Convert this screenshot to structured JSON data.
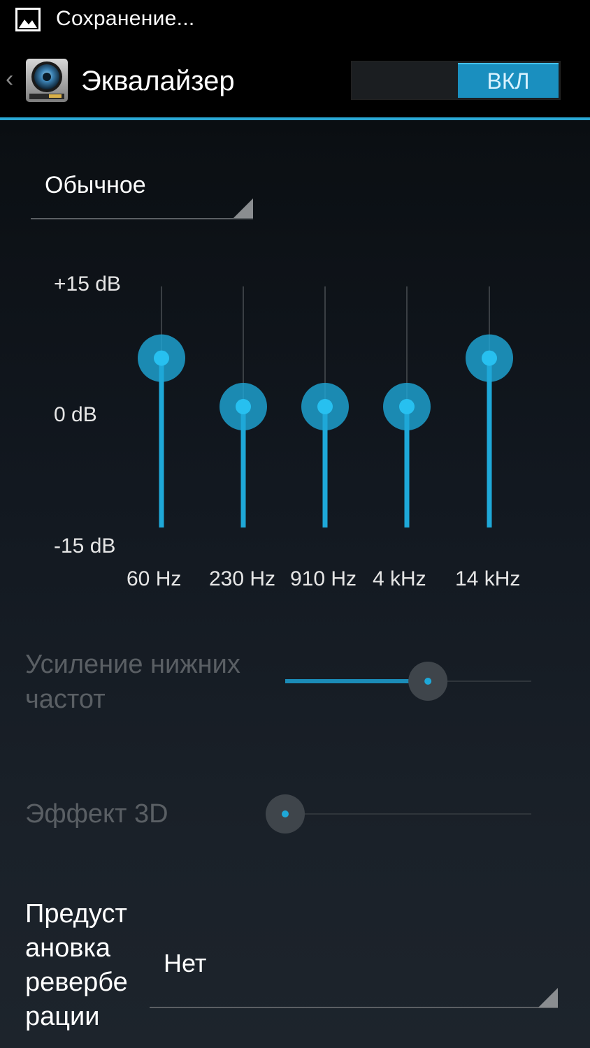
{
  "status_bar": {
    "notification_icon": "image-icon",
    "text": "Сохранение..."
  },
  "action_bar": {
    "back_icon": "chevron-left-icon",
    "app_icon": "speaker-icon",
    "title": "Эквалайзер",
    "toggle": {
      "label": "ВКЛ",
      "state": "on"
    }
  },
  "preset": {
    "value": "Обычное"
  },
  "equalizer": {
    "db_labels": {
      "top": "+15 dB",
      "middle": "0 dB",
      "bottom": "-15 dB"
    },
    "range_db": [
      -15,
      15
    ],
    "bands": [
      {
        "label": "60 Hz",
        "gain_db": 3
      },
      {
        "label": "230 Hz",
        "gain_db": 0
      },
      {
        "label": "910 Hz",
        "gain_db": 0
      },
      {
        "label": "4 kHz",
        "gain_db": 0
      },
      {
        "label": "14 kHz",
        "gain_db": 3
      }
    ],
    "accent_color": "#1ea8d8"
  },
  "bass_boost": {
    "label": "Усиление нижних частот",
    "value_fraction": 0.58,
    "enabled": false
  },
  "virtualizer": {
    "label": "Эффект 3D",
    "value_fraction": 0.0,
    "enabled": false
  },
  "reverb": {
    "label": "Предуст ановка ревербе рации",
    "value": "Нет"
  }
}
